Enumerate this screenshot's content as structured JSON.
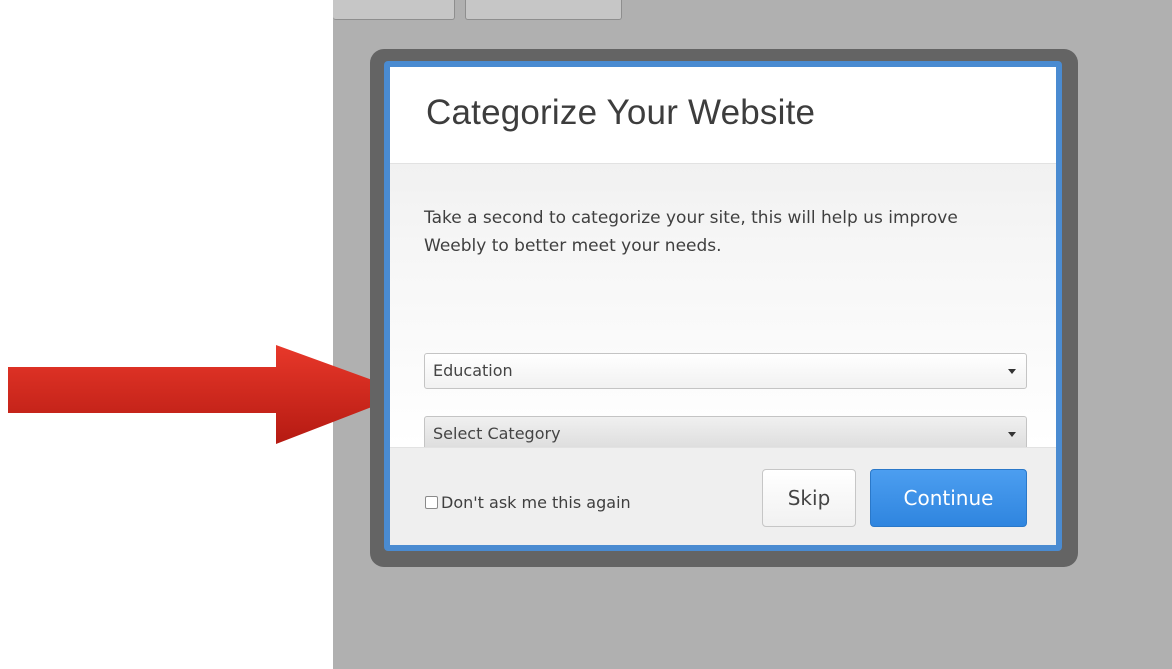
{
  "modal": {
    "title": "Categorize Your Website",
    "description": "Take a second to categorize your site, this will help us improve Weebly to better meet your needs.",
    "primary_category": {
      "selected": "Education"
    },
    "sub_category": {
      "selected": "Select Category"
    },
    "footer": {
      "checkbox_label": "Don't ask me this again",
      "checkbox_checked": false,
      "skip_label": "Skip",
      "continue_label": "Continue"
    }
  },
  "annotation": {
    "icon": "arrow-right-icon",
    "color": "#d92a1c"
  },
  "colors": {
    "accent": "#3a8ee6",
    "frame": "#646464",
    "modal_border": "#4a8bd1",
    "backdrop": "#b0b0b0"
  }
}
